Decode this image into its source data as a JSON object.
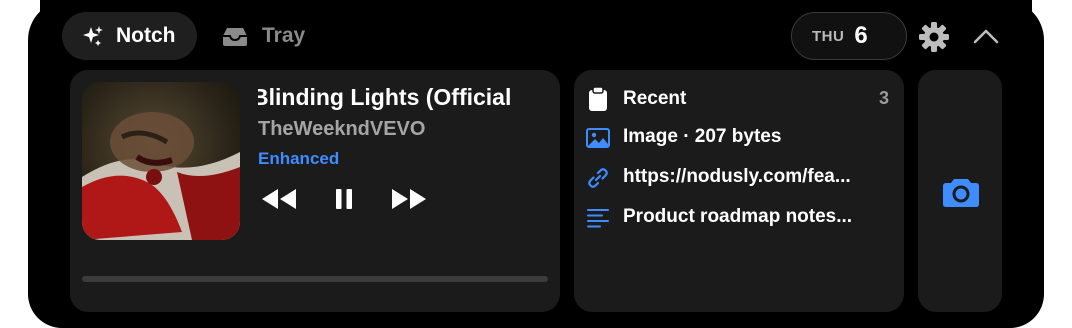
{
  "tabs": [
    {
      "label": "Notch",
      "active": true,
      "icon": "sparkles-icon"
    },
    {
      "label": "Tray",
      "active": false,
      "icon": "tray-icon"
    }
  ],
  "date": {
    "weekday": "THU",
    "day": "6"
  },
  "media": {
    "title": "Blinding Lights (Official",
    "artist": "TheWeekndVEVO",
    "badge": "Enhanced",
    "progress": 0,
    "controls": [
      "rewind-icon",
      "pause-icon",
      "fast-forward-icon"
    ]
  },
  "clipboard": {
    "header": "Recent",
    "count": "3",
    "items": [
      {
        "icon": "image-icon",
        "text": "Image · 207 bytes"
      },
      {
        "icon": "link-icon",
        "text": "https://nodusly.com/fea..."
      },
      {
        "icon": "text-lines-icon",
        "text": "Product roadmap notes..."
      }
    ]
  },
  "colors": {
    "accent": "#3f8cff",
    "panel": "#000000",
    "card": "#1b1b1b"
  }
}
